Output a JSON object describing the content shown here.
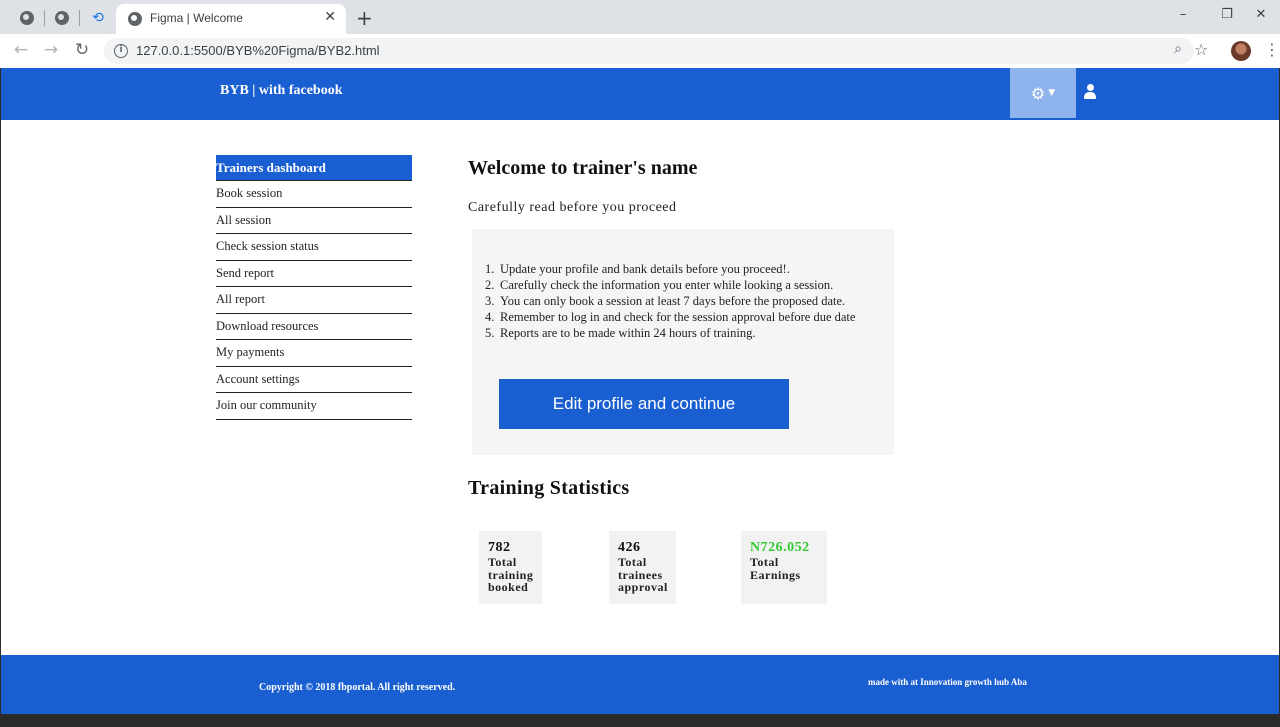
{
  "browser": {
    "tab_title": "Figma | Welcome",
    "url": "127.0.0.1:5500/BYB%20Figma/BYB2.html",
    "icons": {
      "pinned_1": "globe-icon",
      "pinned_2": "globe-icon",
      "pinned_3": "history-icon",
      "favicon": "globe-icon",
      "close": "close-icon",
      "new_tab": "plus-icon",
      "back": "back-arrow-icon",
      "forward": "forward-arrow-icon",
      "reload": "reload-icon",
      "info": "info-icon",
      "zoom": "zoom-icon",
      "bookmark": "star-icon",
      "minimize": "minimize-icon",
      "restore": "restore-icon",
      "close_window": "close-window-icon"
    }
  },
  "header": {
    "brand": "BYB | with facebook",
    "color": "#1a5fd1",
    "settings_icon": "gear-icon",
    "user_icon": "user-icon"
  },
  "sidebar": {
    "items": [
      {
        "label": "Trainers dashboard",
        "active": true
      },
      {
        "label": "Book session"
      },
      {
        "label": "All session"
      },
      {
        "label": "Check session status"
      },
      {
        "label": "Send report"
      },
      {
        "label": "All report"
      },
      {
        "label": "Download resources"
      },
      {
        "label": "My payments"
      },
      {
        "label": "Account settings"
      },
      {
        "label": "Join our community"
      }
    ]
  },
  "main": {
    "welcome_title": "Welcome to trainer's name",
    "subtitle": "Carefully read before you proceed",
    "notices": [
      {
        "num": "1.",
        "text": "Update your profile and bank details before you proceed!."
      },
      {
        "num": "2.",
        "text": "Carefully check the information you enter while looking a session."
      },
      {
        "num": "3.",
        "text": "You can only book a session at least 7 days before the proposed date."
      },
      {
        "num": "4.",
        "text": "Remember to log in and check for the session approval before due date"
      },
      {
        "num": "5.",
        "text": "Reports are to be made within 24 hours of training."
      }
    ],
    "edit_button": "Edit profile and continue"
  },
  "stats": {
    "title": "Training Statistics",
    "cards": [
      {
        "value": "782",
        "label_lines": [
          "Total",
          "training",
          "booked"
        ]
      },
      {
        "value": "426",
        "label_lines": [
          "Total",
          "trainees",
          "approval"
        ]
      },
      {
        "value": "N726.052",
        "label_lines": [
          "Total",
          "Earnings"
        ],
        "value_color": "#32c832"
      }
    ]
  },
  "footer": {
    "copyright": "Copyright © 2018 fbportal. All right reserved.",
    "made_with": "made with at Innovation growth hub Aba"
  }
}
